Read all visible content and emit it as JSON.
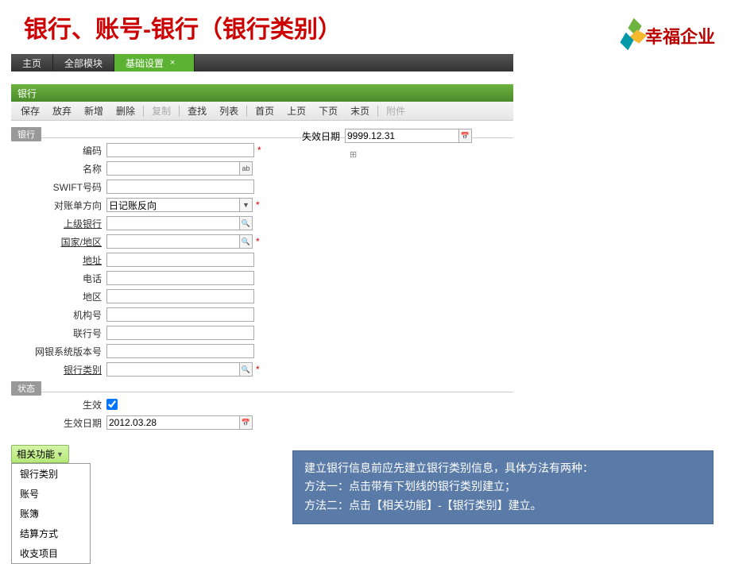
{
  "header": {
    "title": "银行、账号-银行（银行类别）"
  },
  "logo": {
    "text": "幸福企业"
  },
  "nav": {
    "items": [
      {
        "label": "主页",
        "active": false
      },
      {
        "label": "全部模块",
        "active": false
      },
      {
        "label": "基础设置",
        "active": true
      }
    ]
  },
  "section": {
    "title": "银行"
  },
  "toolbar": {
    "save": "保存",
    "abandon": "放弃",
    "new": "新增",
    "delete": "删除",
    "copy": "复制",
    "find": "查找",
    "list": "列表",
    "first": "首页",
    "prev": "上页",
    "next": "下页",
    "last": "末页",
    "attach": "附件"
  },
  "groups": {
    "bank": "银行",
    "status": "状态"
  },
  "fields": {
    "code": {
      "label": "编码",
      "value": "",
      "required": true
    },
    "name": {
      "label": "名称",
      "value": "",
      "hint": "ab"
    },
    "swift": {
      "label": "SWIFT号码",
      "value": ""
    },
    "direction": {
      "label": "对账单方向",
      "value": "日记账反向",
      "required": true
    },
    "parent": {
      "label": "上级银行",
      "value": ""
    },
    "country": {
      "label": "国家/地区",
      "value": "",
      "required": true
    },
    "address": {
      "label": "地址",
      "value": ""
    },
    "phone": {
      "label": "电话",
      "value": ""
    },
    "region": {
      "label": "地区",
      "value": ""
    },
    "orgno": {
      "label": "机构号",
      "value": ""
    },
    "linkno": {
      "label": "联行号",
      "value": ""
    },
    "ebank": {
      "label": "网银系统版本号",
      "value": ""
    },
    "category": {
      "label": "银行类别",
      "value": "",
      "required": true
    },
    "effective": {
      "label": "生效",
      "value": true
    },
    "effdate": {
      "label": "生效日期",
      "value": "2012.03.28"
    },
    "expdate": {
      "label": "失效日期",
      "value": "9999.12.31"
    }
  },
  "related": {
    "button": "相关功能",
    "items": [
      "银行类别",
      "账号",
      "账簿",
      "结算方式",
      "收支项目"
    ]
  },
  "help": {
    "line1": "建立银行信息前应先建立银行类别信息，具体方法有两种：",
    "line2": "方法一：点击带有下划线的银行类别建立；",
    "line3": "方法二：点击【相关功能】-【银行类别】建立。"
  }
}
